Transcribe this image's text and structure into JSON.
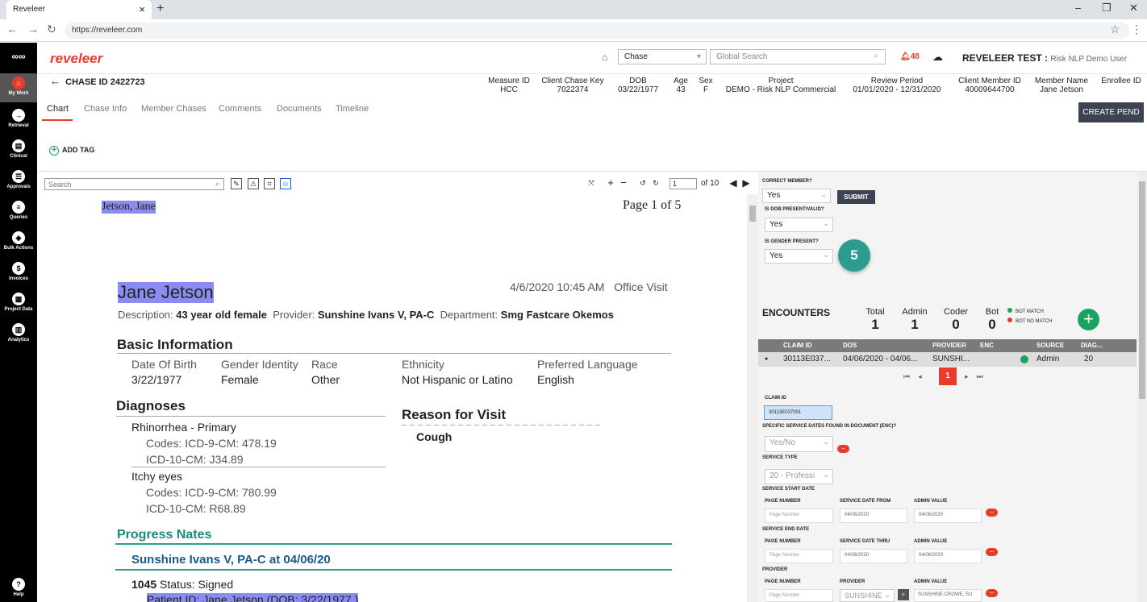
{
  "browser": {
    "tab_title": "Reveleer",
    "url": "https://reveleer.com"
  },
  "nav": {
    "items": [
      {
        "label": "My Work",
        "icon": "home-icon"
      },
      {
        "label": "Retrieval",
        "icon": "retrieval-icon"
      },
      {
        "label": "Clinical",
        "icon": "clinical-icon"
      },
      {
        "label": "Approvals",
        "icon": "approvals-icon"
      },
      {
        "label": "Queries",
        "icon": "queries-icon"
      },
      {
        "label": "Bulk Actions",
        "icon": "bulk-actions-icon"
      },
      {
        "label": "Invoices",
        "icon": "invoices-icon"
      },
      {
        "label": "Project Data",
        "icon": "project-data-icon"
      },
      {
        "label": "Analytics",
        "icon": "analytics-icon"
      }
    ],
    "help": "Help"
  },
  "header": {
    "logo": "reveleer",
    "chase_select": "Chase",
    "search_placeholder": "Global Search",
    "notifications": "48",
    "user_name": "REVELEER TEST :",
    "user_role": "Risk NLP Demo User"
  },
  "chase": {
    "title": "CHASE ID 2422723",
    "columns": [
      {
        "label": "Measure ID",
        "value": "HCC"
      },
      {
        "label": "Client Chase Key",
        "value": "7022374"
      },
      {
        "label": "DOB",
        "value": "03/22/1977"
      },
      {
        "label": "Age",
        "value": "43"
      },
      {
        "label": "Sex",
        "value": "F"
      },
      {
        "label": "Project",
        "value": "DEMO - Risk NLP Commercial"
      },
      {
        "label": "Review Period",
        "value": "01/01/2020 - 12/31/2020"
      },
      {
        "label": "Client Member ID",
        "value": "40009644700"
      },
      {
        "label": "Member Name",
        "value": "Jane Jetson"
      },
      {
        "label": "Enrollee ID",
        "value": ""
      }
    ]
  },
  "tabs": [
    "Chart",
    "Chase Info",
    "Member Chases",
    "Comments",
    "Documents",
    "Timeline"
  ],
  "create_pend": "CREATE PEND",
  "add_tag": "ADD TAG",
  "viewer": {
    "search_placeholder": "Search",
    "page": "1",
    "of": "of 10"
  },
  "document": {
    "header_name": "Jetson, Jane",
    "page_label": "Page 1 of 5",
    "patient_name": "Jane Jetson",
    "visit": "4/6/2020 10:45 AM   Office Visit",
    "desc_label": "Description:",
    "desc_value": "43 year old female",
    "provider_label": "Provider:",
    "provider_value": "Sunshine Ivans V, PA-C",
    "dept_label": "Department:",
    "dept_value": "Smg Fastcare Okemos",
    "basic_info": "Basic Information",
    "info_headers": [
      "Date Of Birth",
      "Gender Identity",
      "Race",
      "Ethnicity",
      "Preferred Language"
    ],
    "info_values": [
      "3/22/1977",
      "Female",
      "Other",
      "Not Hispanic or Latino",
      "English"
    ],
    "diagnoses": "Diagnoses",
    "dx1": "Rhinorrhea  - Primary",
    "dx1_c1": "Codes: ICD-9-CM: 478.19",
    "dx1_c2": "ICD-10-CM: J34.89",
    "dx2": "Itchy eyes",
    "dx2_c1": "Codes: ICD-9-CM: 780.99",
    "dx2_c2": "ICD-10-CM: R68.89",
    "reason": "Reason for Visit",
    "reason_value": "Cough",
    "progress": "Progress Nates",
    "provider_line": "Sunshine Ivans V, PA-C at 04/06/20",
    "status_time": "1045",
    "status": "Status: Signed",
    "patient_id": "Patient ID: Jane Jetson (DOB: 3/22/1977 )"
  },
  "panel": {
    "correct_member": "CORRECT MEMBER?",
    "correct_member_val": "Yes",
    "submit": "SUBMIT",
    "dob_valid": "IS DOB PRESENT/VALID?",
    "dob_valid_val": "Yes",
    "gender": "IS GENDER PRESENT?",
    "gender_val": "Yes",
    "step": "5",
    "encounters": "ENCOUNTERS",
    "stats": [
      {
        "label": "Total",
        "value": "1"
      },
      {
        "label": "Admin",
        "value": "1"
      },
      {
        "label": "Coder",
        "value": "0"
      },
      {
        "label": "Bot",
        "value": "0"
      }
    ],
    "legend": [
      {
        "label": "BOT MATCH",
        "color": "#1aa260"
      },
      {
        "label": "BOT NO MATCH",
        "color": "#e73c2a"
      }
    ],
    "table_headers": [
      "CLAIM ID",
      "DOS",
      "PROVIDER",
      "ENC",
      "SOURCE",
      "DIAG..."
    ],
    "row": {
      "claim": "30113E037...",
      "dos": "04/06/2020 - 04/06...",
      "provider": "SUNSHI...",
      "source": "Admin",
      "diag": "20"
    },
    "current_page": "1",
    "claim_id": "CLAIM ID",
    "claim_id_val": "30113E037001",
    "specific": "SPECIFIC SERVICE DATES FOUND IN DOCUMENT (ENC)?",
    "specific_val": "Yes/No",
    "service_type": "SERVICE TYPE",
    "service_type_val": "20 - Professi",
    "start": "SERVICE START DATE",
    "end": "SERVICE END DATE",
    "provider": "PROVIDER",
    "page_number": "PAGE NUMBER",
    "date_from": "SERVICE DATE FROM",
    "date_thru": "SERVICE DATE THRU",
    "admin_value": "ADMIN VALUE",
    "provider_col": "PROVIDER",
    "page_placeholder": "Page Number",
    "from_val": "04/06/2020",
    "admin_from": "04/06/2020",
    "thru_val": "04/06/2020",
    "admin_thru": "04/06/2020",
    "provider_val": "SUNSHINE",
    "admin_provider": "SUNSHINE CROWE, SU"
  }
}
